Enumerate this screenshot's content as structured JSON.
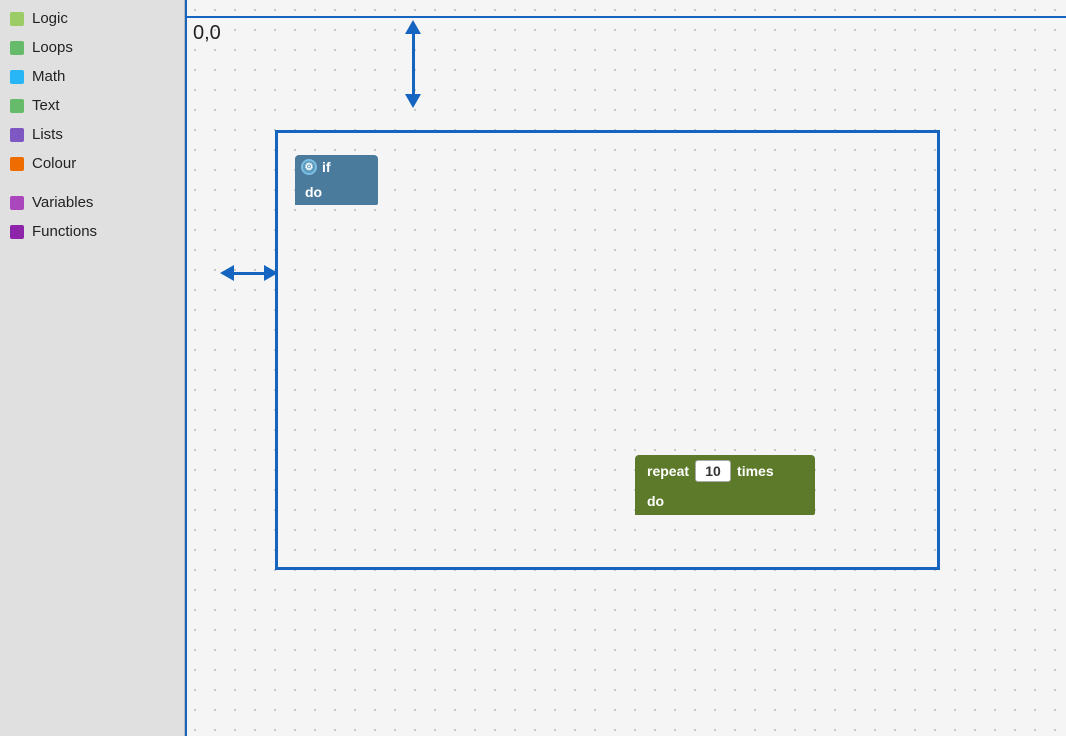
{
  "sidebar": {
    "items": [
      {
        "id": "logic",
        "label": "Logic",
        "color": "#6fa55a"
      },
      {
        "id": "loops",
        "label": "Loops",
        "color": "#5ab55a"
      },
      {
        "id": "math",
        "label": "Math",
        "color": "#5a9dab"
      },
      {
        "id": "text",
        "label": "Text",
        "color": "#5aab6f"
      },
      {
        "id": "lists",
        "label": "Lists",
        "color": "#6f6fab"
      },
      {
        "id": "colour",
        "label": "Colour",
        "color": "#ab5a2a"
      },
      {
        "id": "variables",
        "label": "Variables",
        "color": "#9c3d9c"
      },
      {
        "id": "functions",
        "label": "Functions",
        "color": "#7c3d9c"
      }
    ]
  },
  "canvas": {
    "coord_label": "0,0"
  },
  "blocks": {
    "if_block": {
      "top_label": "if",
      "bottom_label": "do",
      "gear_icon": "⚙"
    },
    "repeat_block": {
      "repeat_label": "repeat",
      "times_label": "times",
      "do_label": "do",
      "count_value": "10"
    }
  }
}
